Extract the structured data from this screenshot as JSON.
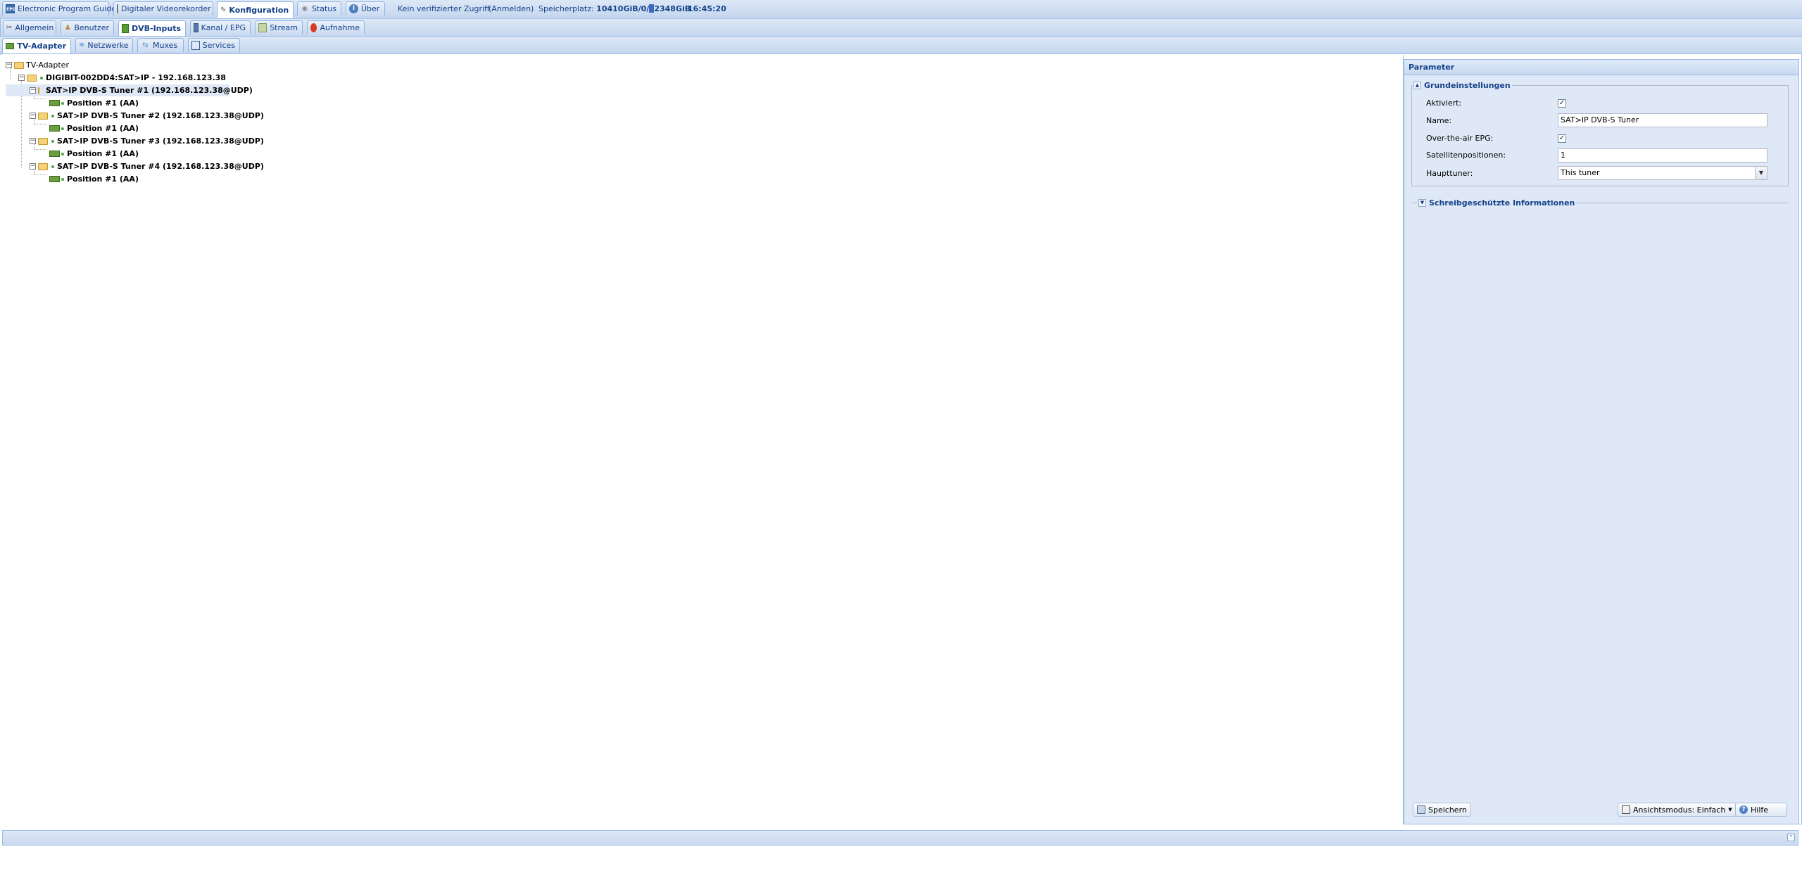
{
  "top_tabs": [
    {
      "label": "Electronic Program Guide",
      "icon": "epg-icon"
    },
    {
      "label": "Digitaler Videorekorder",
      "icon": "dvr-icon"
    },
    {
      "label": "Konfiguration",
      "icon": "wrench-icon",
      "active": true
    },
    {
      "label": "Status",
      "icon": "status-icon"
    },
    {
      "label": "Über",
      "icon": "info-icon"
    }
  ],
  "toolbar": {
    "access_text": "Kein verifizierter Zugriff",
    "login_link": "(Anmelden)",
    "storage_label": "Speicherplatz:",
    "storage_value_a": "10410GiB/0/",
    "storage_value_b": "2348GiB",
    "time": "16:45:20"
  },
  "config_tabs": [
    {
      "label": "Allgemein",
      "icon": "wrench-icon"
    },
    {
      "label": "Benutzer",
      "icon": "user-icon"
    },
    {
      "label": "DVB-Inputs",
      "icon": "dvb-icon",
      "active": true
    },
    {
      "label": "Kanal / EPG",
      "icon": "tv-icon"
    },
    {
      "label": "Stream",
      "icon": "stream-icon"
    },
    {
      "label": "Aufnahme",
      "icon": "record-icon"
    }
  ],
  "dvb_tabs": [
    {
      "label": "TV-Adapter",
      "icon": "adapter-icon",
      "active": true
    },
    {
      "label": "Netzwerke",
      "icon": "network-icon"
    },
    {
      "label": "Muxes",
      "icon": "mux-icon"
    },
    {
      "label": "Services",
      "icon": "services-icon"
    }
  ],
  "tree": {
    "root": "TV-Adapter",
    "device": "DIGIBIT-002DD4:SAT>IP - 192.168.123.38",
    "tuners": [
      {
        "label": "SAT>IP DVB-S Tuner #1 (192.168.123.38@UDP)",
        "position": "Position #1 (AA)",
        "selected": true
      },
      {
        "label": "SAT>IP DVB-S Tuner #2 (192.168.123.38@UDP)",
        "position": "Position #1 (AA)"
      },
      {
        "label": "SAT>IP DVB-S Tuner #3 (192.168.123.38@UDP)",
        "position": "Position #1 (AA)"
      },
      {
        "label": "SAT>IP DVB-S Tuner #4 (192.168.123.38@UDP)",
        "position": "Position #1 (AA)"
      }
    ]
  },
  "params": {
    "title": "Parameter",
    "basic_legend": "Grundeinstellungen",
    "fields": {
      "enabled_label": "Aktiviert:",
      "enabled": true,
      "name_label": "Name:",
      "name_value": "SAT>IP DVB-S Tuner",
      "epg_label": "Over-the-air EPG:",
      "epg": true,
      "satpos_label": "Satellitenpositionen:",
      "satpos_value": "1",
      "master_label": "Haupttuner:",
      "master_value": "This tuner"
    },
    "readonly_legend": "Schreibgeschützte Informationen",
    "save_button": "Speichern",
    "view_mode_button": "Ansichtsmodus: Einfach",
    "help_button": "Hilfe"
  },
  "colors": {
    "accent": "#15428b",
    "border": "#99bbe8",
    "panel_bg": "#dfe8f6"
  }
}
